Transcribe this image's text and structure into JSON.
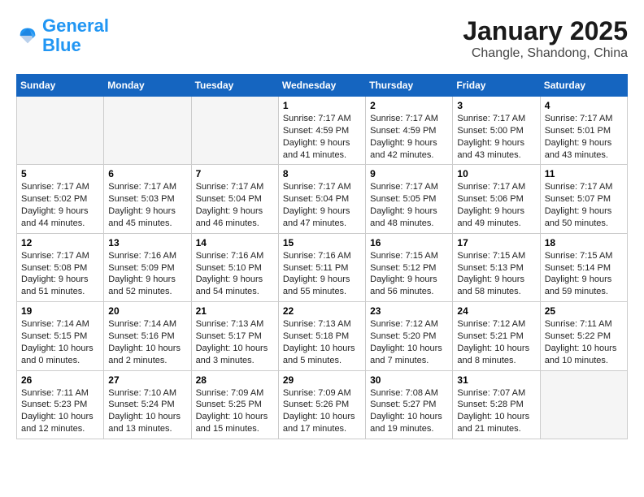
{
  "header": {
    "logo_general": "General",
    "logo_blue": "Blue",
    "month_title": "January 2025",
    "location": "Changle, Shandong, China"
  },
  "weekdays": [
    "Sunday",
    "Monday",
    "Tuesday",
    "Wednesday",
    "Thursday",
    "Friday",
    "Saturday"
  ],
  "weeks": [
    [
      {
        "day": "",
        "info": ""
      },
      {
        "day": "",
        "info": ""
      },
      {
        "day": "",
        "info": ""
      },
      {
        "day": "1",
        "info": "Sunrise: 7:17 AM\nSunset: 4:59 PM\nDaylight: 9 hours\nand 41 minutes."
      },
      {
        "day": "2",
        "info": "Sunrise: 7:17 AM\nSunset: 4:59 PM\nDaylight: 9 hours\nand 42 minutes."
      },
      {
        "day": "3",
        "info": "Sunrise: 7:17 AM\nSunset: 5:00 PM\nDaylight: 9 hours\nand 43 minutes."
      },
      {
        "day": "4",
        "info": "Sunrise: 7:17 AM\nSunset: 5:01 PM\nDaylight: 9 hours\nand 43 minutes."
      }
    ],
    [
      {
        "day": "5",
        "info": "Sunrise: 7:17 AM\nSunset: 5:02 PM\nDaylight: 9 hours\nand 44 minutes."
      },
      {
        "day": "6",
        "info": "Sunrise: 7:17 AM\nSunset: 5:03 PM\nDaylight: 9 hours\nand 45 minutes."
      },
      {
        "day": "7",
        "info": "Sunrise: 7:17 AM\nSunset: 5:04 PM\nDaylight: 9 hours\nand 46 minutes."
      },
      {
        "day": "8",
        "info": "Sunrise: 7:17 AM\nSunset: 5:04 PM\nDaylight: 9 hours\nand 47 minutes."
      },
      {
        "day": "9",
        "info": "Sunrise: 7:17 AM\nSunset: 5:05 PM\nDaylight: 9 hours\nand 48 minutes."
      },
      {
        "day": "10",
        "info": "Sunrise: 7:17 AM\nSunset: 5:06 PM\nDaylight: 9 hours\nand 49 minutes."
      },
      {
        "day": "11",
        "info": "Sunrise: 7:17 AM\nSunset: 5:07 PM\nDaylight: 9 hours\nand 50 minutes."
      }
    ],
    [
      {
        "day": "12",
        "info": "Sunrise: 7:17 AM\nSunset: 5:08 PM\nDaylight: 9 hours\nand 51 minutes."
      },
      {
        "day": "13",
        "info": "Sunrise: 7:16 AM\nSunset: 5:09 PM\nDaylight: 9 hours\nand 52 minutes."
      },
      {
        "day": "14",
        "info": "Sunrise: 7:16 AM\nSunset: 5:10 PM\nDaylight: 9 hours\nand 54 minutes."
      },
      {
        "day": "15",
        "info": "Sunrise: 7:16 AM\nSunset: 5:11 PM\nDaylight: 9 hours\nand 55 minutes."
      },
      {
        "day": "16",
        "info": "Sunrise: 7:15 AM\nSunset: 5:12 PM\nDaylight: 9 hours\nand 56 minutes."
      },
      {
        "day": "17",
        "info": "Sunrise: 7:15 AM\nSunset: 5:13 PM\nDaylight: 9 hours\nand 58 minutes."
      },
      {
        "day": "18",
        "info": "Sunrise: 7:15 AM\nSunset: 5:14 PM\nDaylight: 9 hours\nand 59 minutes."
      }
    ],
    [
      {
        "day": "19",
        "info": "Sunrise: 7:14 AM\nSunset: 5:15 PM\nDaylight: 10 hours\nand 0 minutes."
      },
      {
        "day": "20",
        "info": "Sunrise: 7:14 AM\nSunset: 5:16 PM\nDaylight: 10 hours\nand 2 minutes."
      },
      {
        "day": "21",
        "info": "Sunrise: 7:13 AM\nSunset: 5:17 PM\nDaylight: 10 hours\nand 3 minutes."
      },
      {
        "day": "22",
        "info": "Sunrise: 7:13 AM\nSunset: 5:18 PM\nDaylight: 10 hours\nand 5 minutes."
      },
      {
        "day": "23",
        "info": "Sunrise: 7:12 AM\nSunset: 5:20 PM\nDaylight: 10 hours\nand 7 minutes."
      },
      {
        "day": "24",
        "info": "Sunrise: 7:12 AM\nSunset: 5:21 PM\nDaylight: 10 hours\nand 8 minutes."
      },
      {
        "day": "25",
        "info": "Sunrise: 7:11 AM\nSunset: 5:22 PM\nDaylight: 10 hours\nand 10 minutes."
      }
    ],
    [
      {
        "day": "26",
        "info": "Sunrise: 7:11 AM\nSunset: 5:23 PM\nDaylight: 10 hours\nand 12 minutes."
      },
      {
        "day": "27",
        "info": "Sunrise: 7:10 AM\nSunset: 5:24 PM\nDaylight: 10 hours\nand 13 minutes."
      },
      {
        "day": "28",
        "info": "Sunrise: 7:09 AM\nSunset: 5:25 PM\nDaylight: 10 hours\nand 15 minutes."
      },
      {
        "day": "29",
        "info": "Sunrise: 7:09 AM\nSunset: 5:26 PM\nDaylight: 10 hours\nand 17 minutes."
      },
      {
        "day": "30",
        "info": "Sunrise: 7:08 AM\nSunset: 5:27 PM\nDaylight: 10 hours\nand 19 minutes."
      },
      {
        "day": "31",
        "info": "Sunrise: 7:07 AM\nSunset: 5:28 PM\nDaylight: 10 hours\nand 21 minutes."
      },
      {
        "day": "",
        "info": ""
      }
    ]
  ]
}
